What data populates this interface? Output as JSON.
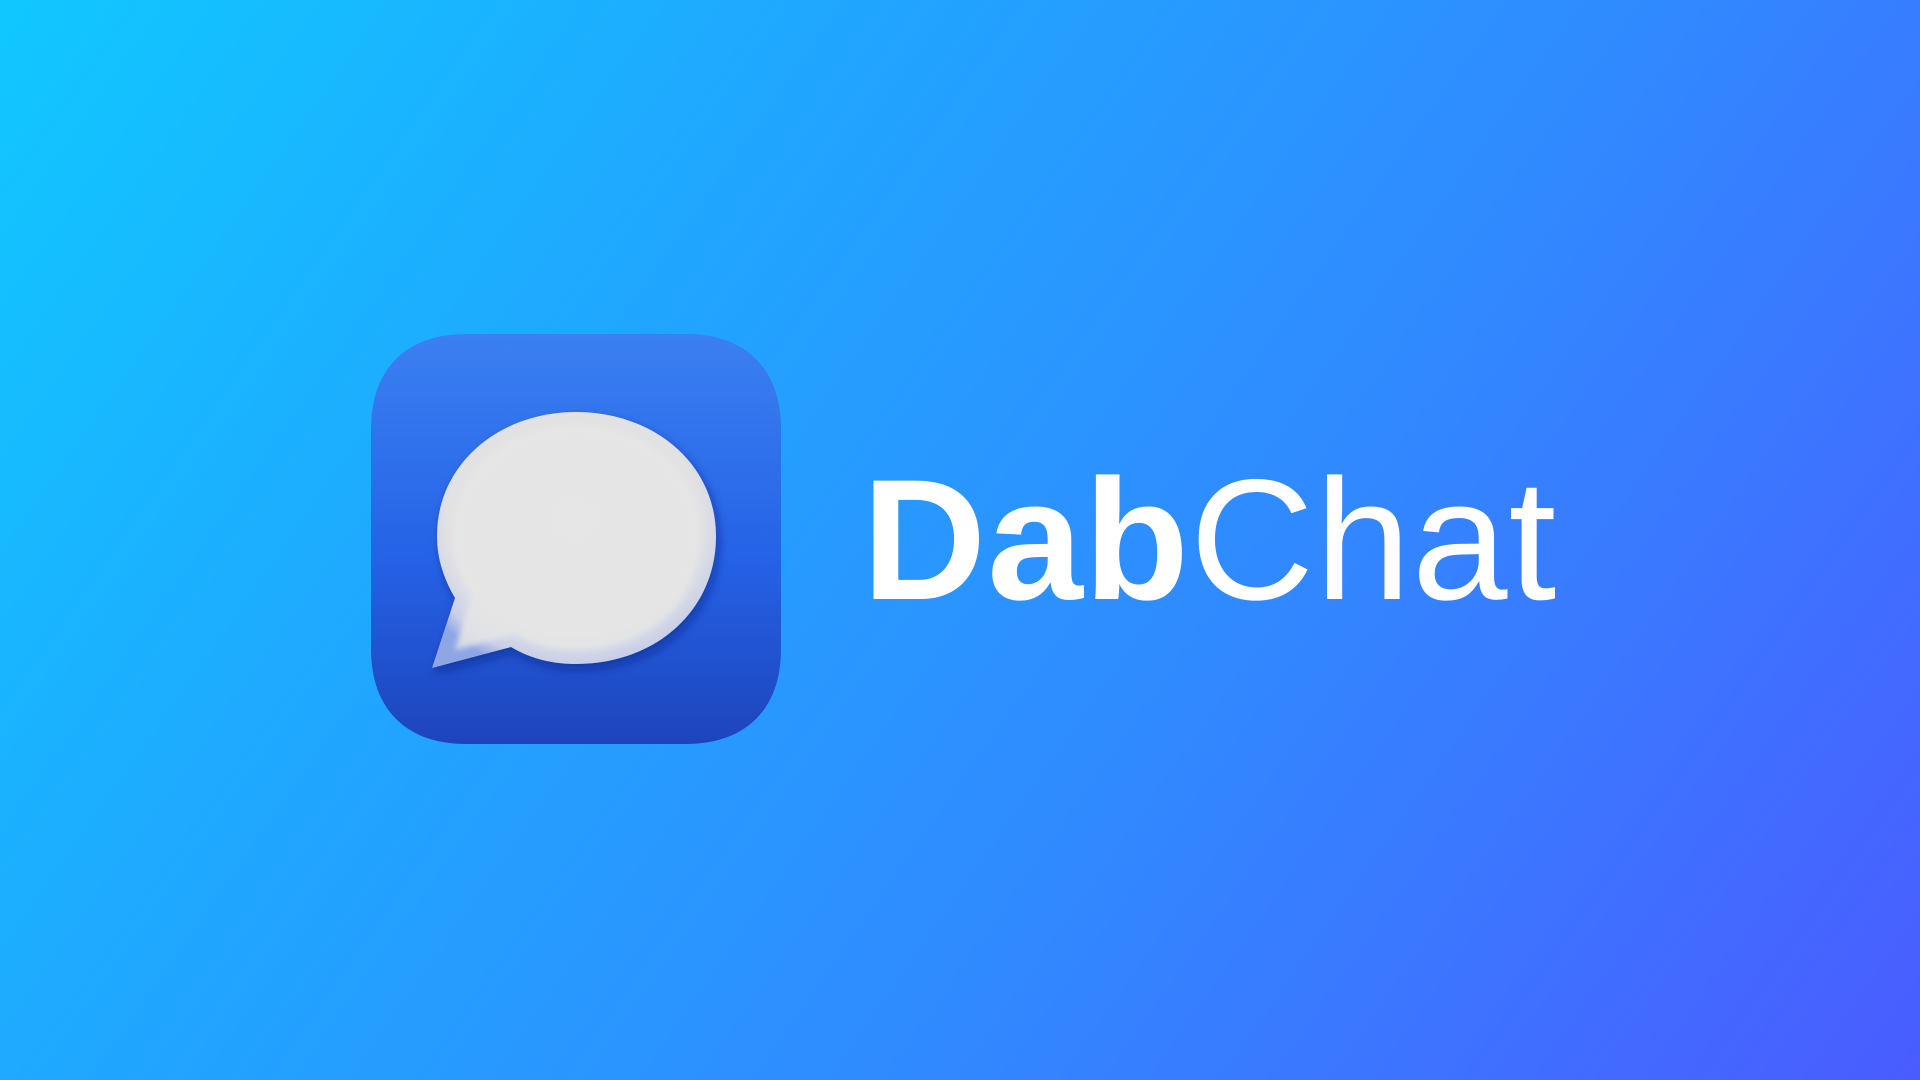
{
  "app": {
    "name_bold": "Dab",
    "name_regular": "Chat"
  },
  "icon": {
    "name": "chat-bubble-icon",
    "tile_color_top": "#3b80f2",
    "tile_color_bottom": "#1d44bc",
    "bubble_color": "#e6e6e6"
  },
  "colors": {
    "background_start": "#10c8ff",
    "background_end": "#4a5cff",
    "text": "#ffffff"
  }
}
